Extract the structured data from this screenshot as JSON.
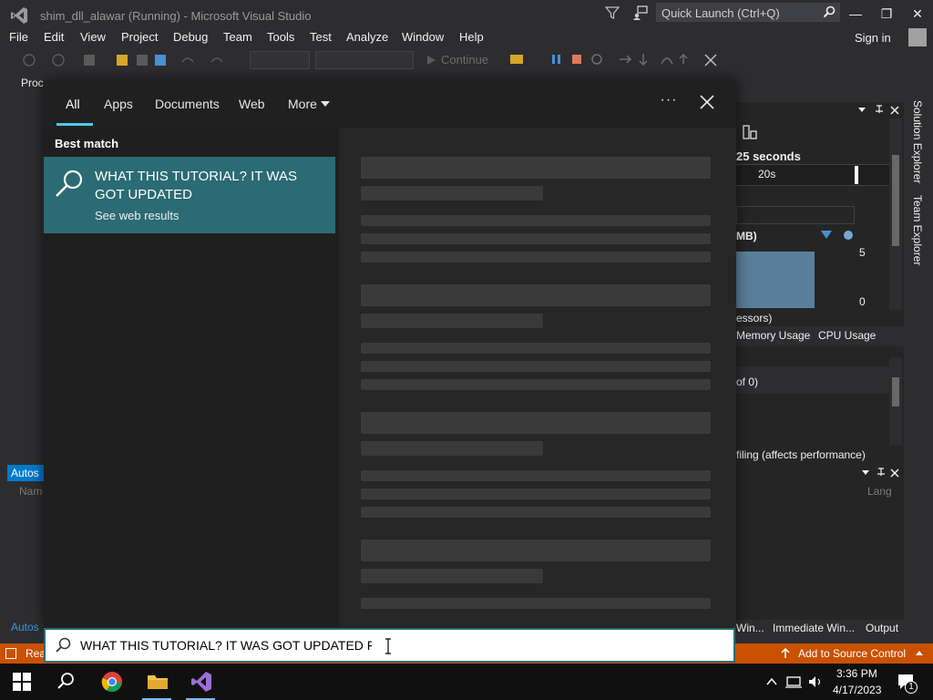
{
  "vs": {
    "title": "shim_dll_alawar (Running) - Microsoft Visual Studio",
    "quick_launch_placeholder": "Quick Launch (Ctrl+Q)",
    "menu": [
      "File",
      "Edit",
      "View",
      "Project",
      "Debug",
      "Team",
      "Tools",
      "Test",
      "Analyze",
      "Window",
      "Help"
    ],
    "sign_in": "Sign in",
    "toolbar": {
      "continue_label": "Continue"
    },
    "proc_label": "Proc",
    "diagnostics": {
      "seconds": "25 seconds",
      "timeline_tick": "20s",
      "mb_label": "MB)",
      "graph_max": "5",
      "graph_min": "0",
      "processors": "essors)",
      "tab_memory": "Memory Usage",
      "tab_cpu": "CPU Usage",
      "of0": "of 0)",
      "profiling": "filing (affects performance)"
    },
    "side_tabs": [
      "Solution Explorer",
      "Team Explorer"
    ],
    "lower_right_lang": "Lang",
    "autos_tab": "Autos",
    "autos_name_col": "Nam",
    "autos_bottom": "Autos",
    "bottom_tabs": [
      "Win...",
      "Immediate Win...",
      "Output"
    ],
    "status": {
      "ready": "Rea",
      "add_source_control": "Add to Source Control"
    }
  },
  "search": {
    "tabs": [
      "All",
      "Apps",
      "Documents",
      "Web",
      "More"
    ],
    "best_match_label": "Best match",
    "best_match_title": "WHAT THIS TUTORIAL? IT WAS GOT UPDATED",
    "best_match_subtitle": "See web results",
    "query": "WHAT THIS TUTORIAL? IT WAS GOT UPDATED FI",
    "accent": "#2b6b73"
  },
  "taskbar": {
    "time": "3:36 PM",
    "date": "4/17/2023",
    "notification_count": "1"
  }
}
